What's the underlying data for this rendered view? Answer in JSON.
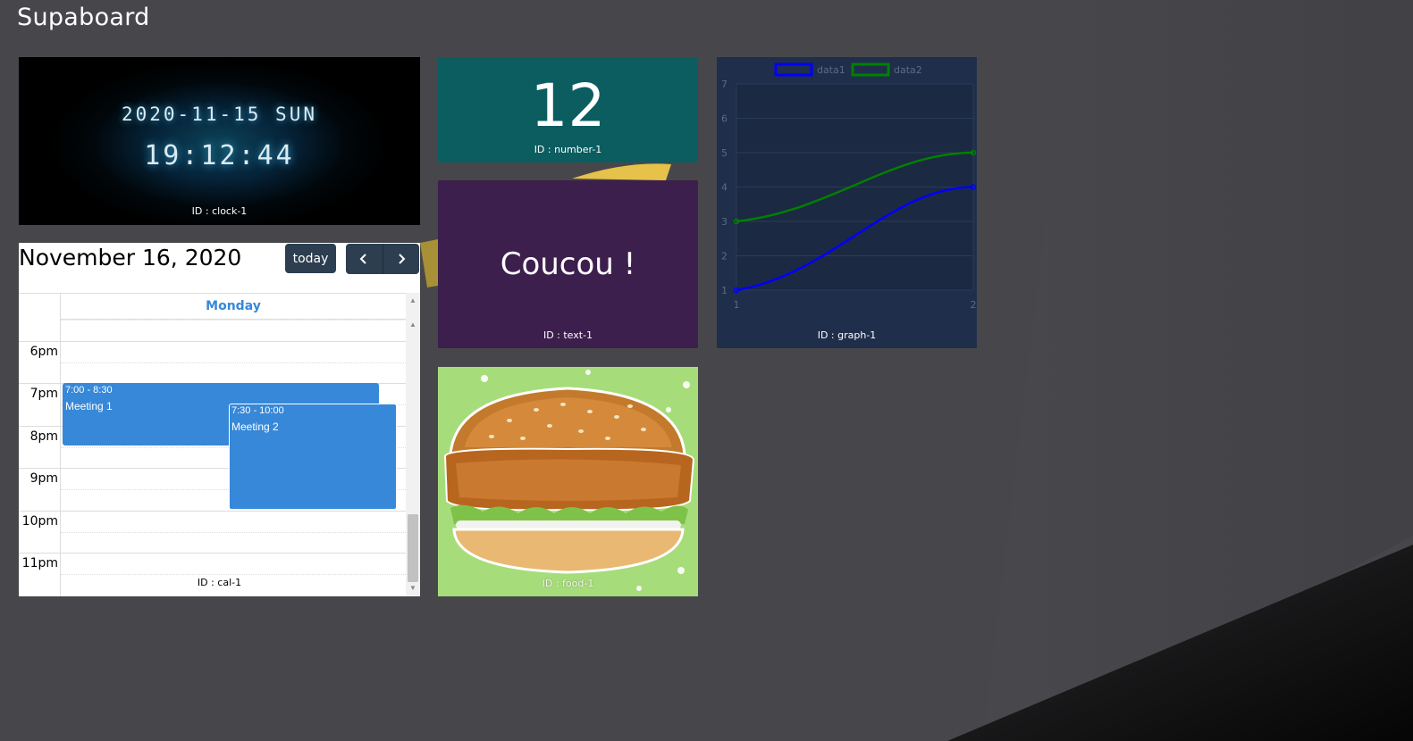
{
  "app": {
    "title": "Supaboard"
  },
  "clock": {
    "date": "2020-11-15 SUN",
    "time": "19:12:44",
    "id_label": "ID : clock-1"
  },
  "number": {
    "value": "12",
    "id_label": "ID : number-1"
  },
  "text": {
    "value": "Coucou !",
    "id_label": "ID : text-1"
  },
  "food": {
    "image": "chicken-burger",
    "id_label": "ID : food-1"
  },
  "graph": {
    "id_label": "ID : graph-1",
    "chart_data": {
      "type": "line",
      "x": [
        1,
        2
      ],
      "series": [
        {
          "name": "data1",
          "values": [
            1,
            4
          ],
          "color": "#0000ff"
        },
        {
          "name": "data2",
          "values": [
            3,
            5
          ],
          "color": "#008000"
        }
      ],
      "ylim": [
        1,
        7
      ],
      "y_ticks": [
        "1",
        "2",
        "3",
        "4",
        "5",
        "6",
        "7"
      ],
      "x_ticks": [
        "1",
        "2"
      ],
      "legend": "top",
      "grid": true
    }
  },
  "calendar": {
    "title": "November 16, 2020",
    "today_label": "today",
    "prev_icon": "chevron-left-icon",
    "next_icon": "chevron-right-icon",
    "day_header": "Monday",
    "hours": [
      "6pm",
      "7pm",
      "8pm",
      "9pm",
      "10pm",
      "11pm"
    ],
    "events": [
      {
        "time": "7:00 - 8:30",
        "title": "Meeting 1"
      },
      {
        "time": "7:30 - 10:00",
        "title": "Meeting 2"
      }
    ],
    "id_label": "ID : cal-1"
  },
  "colors": {
    "background": "#47474b",
    "number_bg": "#0b5d60",
    "text_bg": "#3d1f4d",
    "graph_bg": "#1f2e4b",
    "event": "#3788d8",
    "button": "#2c3e50"
  }
}
